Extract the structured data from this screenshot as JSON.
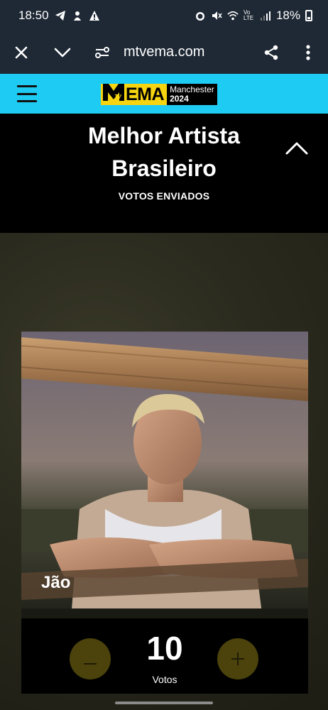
{
  "status_bar": {
    "time": "18:50",
    "left_icons": [
      "telegram-icon",
      "notification-icon",
      "warning-icon"
    ],
    "right_icons": [
      "alarm-icon",
      "mute-icon",
      "wifi-icon",
      "volte-icon",
      "signal-icon"
    ],
    "battery": "18%"
  },
  "browser": {
    "url": "mtvema.com",
    "icons": [
      "close-icon",
      "chevron-down-icon",
      "site-settings-icon",
      "share-icon",
      "more-vert-icon"
    ]
  },
  "site_header": {
    "logo_ema": "EMA",
    "logo_city": "Manchester",
    "logo_year": "2024",
    "bg_color": "#1ecbf2"
  },
  "category": {
    "title_line1": "Melhor Artista",
    "title_line2": "Brasileiro",
    "status": "VOTOS ENVIADOS"
  },
  "nominee": {
    "name": "Jão",
    "votes": "10",
    "votes_label": "Votos",
    "button_color": "#4b430b"
  }
}
